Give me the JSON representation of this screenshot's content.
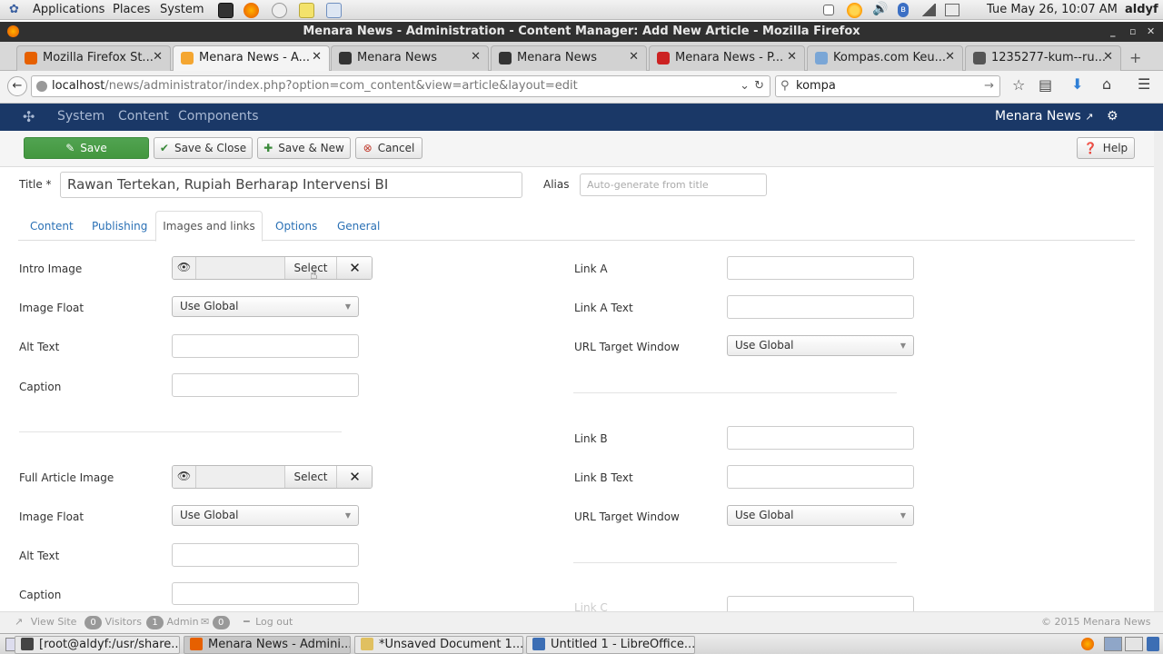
{
  "gnome_panel": {
    "menus": [
      "Applications",
      "Places",
      "System"
    ],
    "clock": "Tue May 26, 10:07 AM",
    "user": "aldyf"
  },
  "window": {
    "title": "Menara News - Administration - Content Manager: Add New Article - Mozilla Firefox"
  },
  "tabs": [
    {
      "label": "Mozilla Firefox St...",
      "active": false,
      "color": "#e66000"
    },
    {
      "label": "Menara News - A...",
      "active": true,
      "color": "#f4a631"
    },
    {
      "label": "Menara News",
      "active": false,
      "color": "#333333"
    },
    {
      "label": "Menara News",
      "active": false,
      "color": "#333333"
    },
    {
      "label": "Menara News - P...",
      "active": false,
      "color": "#cc2222"
    },
    {
      "label": "Kompas.com Keu...",
      "active": false,
      "color": "#7aa6d6"
    },
    {
      "label": "1235277-kum--ru...",
      "active": false,
      "color": "#555555"
    }
  ],
  "navbar": {
    "url_host": "localhost",
    "url_path": "/news/administrator/index.php?option=com_content&view=article&layout=edit",
    "search_value": "kompa"
  },
  "joomla_header": {
    "menu": [
      "System",
      "Content",
      "Components"
    ],
    "site_link": "Menara News"
  },
  "toolbar": {
    "save": "Save",
    "save_close": "Save & Close",
    "save_new": "Save & New",
    "cancel": "Cancel",
    "help": "Help"
  },
  "form": {
    "title_label": "Title *",
    "title_value": "Rawan Tertekan, Rupiah Berharap Intervensi BI",
    "alias_label": "Alias",
    "alias_placeholder": "Auto-generate from title"
  },
  "form_tabs": [
    "Content",
    "Publishing",
    "Images and links",
    "Options",
    "General"
  ],
  "images": {
    "intro_label": "Intro Image",
    "full_label": "Full Article Image",
    "float_label": "Image Float",
    "alt_label": "Alt Text",
    "caption_label": "Caption",
    "select_label": "Select",
    "float_value": "Use Global"
  },
  "links": {
    "link_a": "Link A",
    "link_a_text": "Link A Text",
    "link_b": "Link B",
    "link_b_text": "Link B Text",
    "link_c": "Link C",
    "target_label": "URL Target Window",
    "target_value": "Use Global"
  },
  "status_bar": {
    "view_site": "View Site",
    "visitors_count": "0",
    "visitors": "Visitors",
    "admin_count": "1",
    "admin": "Admin",
    "msg_count": "0",
    "logout": "Log out",
    "copyright": "© 2015 Menara News"
  },
  "taskbar": [
    {
      "label": "[root@aldyf:/usr/share...",
      "active": false,
      "color": "#444444"
    },
    {
      "label": "Menara News - Admini...",
      "active": true,
      "color": "#e66000"
    },
    {
      "label": "*Unsaved Document 1...",
      "active": false,
      "color": "#e0c060"
    },
    {
      "label": "Untitled 1 - LibreOffice...",
      "active": false,
      "color": "#3c6eb4"
    }
  ]
}
